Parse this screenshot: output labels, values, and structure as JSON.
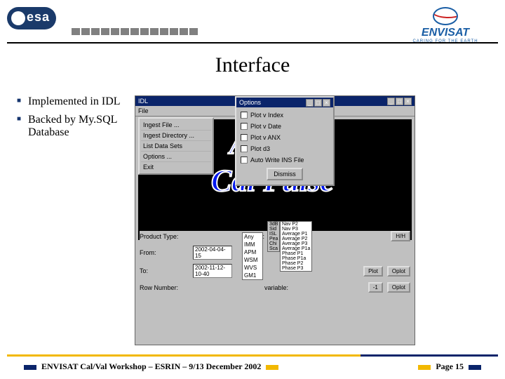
{
  "header": {
    "esa_text": "esa",
    "envisat": "ENVISAT",
    "envisat_sub": "CARING FOR THE EARTH"
  },
  "title": "Interface",
  "bullets": [
    "Implemented in IDL",
    "Backed by My.SQL Database"
  ],
  "idl_window": {
    "title": "IDL",
    "menu_file": "File",
    "popup_file": [
      "Ingest File ...",
      "Ingest Directory ...",
      "List Data Sets",
      "Options ...",
      "Exit"
    ],
    "asar_line1": "ASAR",
    "asar_line2": "Cal Pulse"
  },
  "options_dialog": {
    "title": "Options",
    "items": [
      "Plot v Index",
      "Plot v Date",
      "Plot v ANX",
      "Plot d3",
      "Auto Write INS File"
    ],
    "dismiss": "Dismiss"
  },
  "form": {
    "product_type": "Product Type:",
    "beam": "Beam:",
    "beam_options": [
      "Any",
      "IMM",
      "APM",
      "WSM",
      "WVS",
      "GM1"
    ],
    "polarisation_hh": "H/H",
    "from": "From:",
    "from_val": "2002-04-04-15",
    "to": "To:",
    "to_val": "2002-11-12-10-40",
    "row_number": "Row Number:",
    "variable": "variable:",
    "btn_plot": "Plot",
    "btn_oplot": "Oplot",
    "btn_minus": "-1",
    "next_options": [
      "Nav P2",
      "Nav P3",
      "Average P1",
      "Average P2",
      "Average P3",
      "Average P1a",
      "Phase P1",
      "Phase P1a",
      "Phase P2",
      "Phase P3"
    ],
    "side_labels": [
      "3dB",
      "Sid",
      "ISL",
      "Pea",
      "Chi",
      "Sca"
    ]
  },
  "footer": {
    "left": "ENVISAT Cal/Val Workshop – ESRIN – 9/13 December 2002",
    "right": "Page 15"
  }
}
